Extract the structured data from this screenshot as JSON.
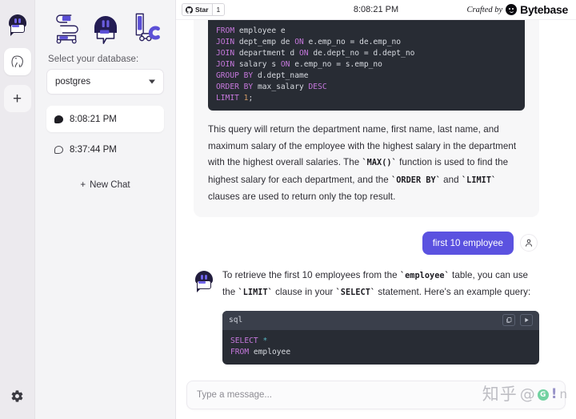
{
  "rail": {
    "items": [
      {
        "name": "bot-logo",
        "icon": "robot-icon"
      },
      {
        "name": "postgres-db",
        "icon": "elephant-icon",
        "active": true
      },
      {
        "name": "add",
        "icon": "plus-icon",
        "label": "+"
      }
    ],
    "settings_icon": "gear-icon"
  },
  "sidebar": {
    "logo_letters": [
      "S",
      "Q",
      "L"
    ],
    "select_label": "Select your database:",
    "database": {
      "value": "postgres",
      "options": [
        "postgres"
      ]
    },
    "chats": [
      {
        "label": "8:08:21 PM",
        "active": true,
        "icon": "chat-bubble-filled-icon"
      },
      {
        "label": "8:37:44 PM",
        "active": false,
        "icon": "chat-bubble-outline-icon"
      }
    ],
    "new_chat_label": "New Chat",
    "new_chat_icon": "plus-icon"
  },
  "topbar": {
    "star_icon": "github-icon",
    "star_label": "Star",
    "star_count": "1",
    "time": "8:08:21 PM",
    "crafted_by": "Crafted by",
    "brand": "Bytebase",
    "brand_icon": "bytebase-logo-icon"
  },
  "chat": {
    "top_code": {
      "language": "sql",
      "lines": [
        {
          "segments": [
            {
              "t": "FROM",
              "c": "kw"
            },
            {
              "t": " employee e",
              "c": ""
            }
          ]
        },
        {
          "segments": [
            {
              "t": "JOIN",
              "c": "kw"
            },
            {
              "t": " dept_emp de ",
              "c": ""
            },
            {
              "t": "ON",
              "c": "kw"
            },
            {
              "t": " e.emp_no = de.emp_no",
              "c": ""
            }
          ]
        },
        {
          "segments": [
            {
              "t": "JOIN",
              "c": "kw"
            },
            {
              "t": " department d ",
              "c": ""
            },
            {
              "t": "ON",
              "c": "kw"
            },
            {
              "t": " de.dept_no = d.dept_no",
              "c": ""
            }
          ]
        },
        {
          "segments": [
            {
              "t": "JOIN",
              "c": "kw"
            },
            {
              "t": " salary s ",
              "c": ""
            },
            {
              "t": "ON",
              "c": "kw"
            },
            {
              "t": " e.emp_no = s.emp_no",
              "c": ""
            }
          ]
        },
        {
          "segments": [
            {
              "t": "GROUP BY",
              "c": "kw"
            },
            {
              "t": " d.dept_name",
              "c": ""
            }
          ]
        },
        {
          "segments": [
            {
              "t": "ORDER BY",
              "c": "kw"
            },
            {
              "t": " max_salary ",
              "c": ""
            },
            {
              "t": "DESC",
              "c": "kw"
            }
          ]
        },
        {
          "segments": [
            {
              "t": "LIMIT",
              "c": "kw"
            },
            {
              "t": " ",
              "c": ""
            },
            {
              "t": "1",
              "c": "num"
            },
            {
              "t": ";",
              "c": ""
            }
          ]
        }
      ],
      "raw": "FROM employee e\nJOIN dept_emp de ON e.emp_no = de.emp_no\nJOIN department d ON de.dept_no = d.dept_no\nJOIN salary s ON e.emp_no = s.emp_no\nGROUP BY d.dept_name\nORDER BY max_salary DESC\nLIMIT 1;"
    },
    "assistant_paragraph_1": {
      "part1": "This query will return the department name, first name, last name, and maximum salary of the employee with the highest salary in the department with the highest overall salaries. The ",
      "code1": "`MAX()`",
      "part2": " function is used to find the highest salary for each department, and the ",
      "code2": "`ORDER BY`",
      "part3": " and ",
      "code3": "`LIMIT`",
      "part4": " clauses are used to return only the top result."
    },
    "user_message": {
      "text": "first 10 employee",
      "avatar_icon": "user-icon"
    },
    "assistant_message_2": {
      "avatar_icon": "robot-icon",
      "part1": "To retrieve the first 10 employees from the ",
      "code1": "`employee`",
      "part2": " table, you can use the ",
      "code2": "`LIMIT`",
      "part3": " clause in your ",
      "code3": "`SELECT`",
      "part4": " statement. Here's an example query:",
      "code_block": {
        "language": "sql",
        "copy_icon": "copy-icon",
        "run_icon": "play-icon",
        "lines": [
          {
            "segments": [
              {
                "t": "SELECT",
                "c": "kw"
              },
              {
                "t": " ",
                "c": ""
              },
              {
                "t": "*",
                "c": "op"
              }
            ]
          },
          {
            "segments": [
              {
                "t": "FROM",
                "c": "kw"
              },
              {
                "t": " employee",
                "c": ""
              }
            ]
          }
        ],
        "raw": "SELECT *\nFROM employee"
      }
    }
  },
  "composer": {
    "placeholder": "Type a message...",
    "value": ""
  },
  "watermark": {
    "cn": "知乎",
    "at": "@",
    "badge": "G",
    "tail": "!",
    "suffix": "n"
  },
  "colors": {
    "accent": "#5b52e0",
    "sidebar_bg": "#f4f4f6",
    "rail_bg": "#eceaee",
    "code_bg": "#282c34",
    "code_header_bg": "#3a3f4b",
    "assistant_bg": "#f7f7f8",
    "keyword": "#c678dd"
  }
}
